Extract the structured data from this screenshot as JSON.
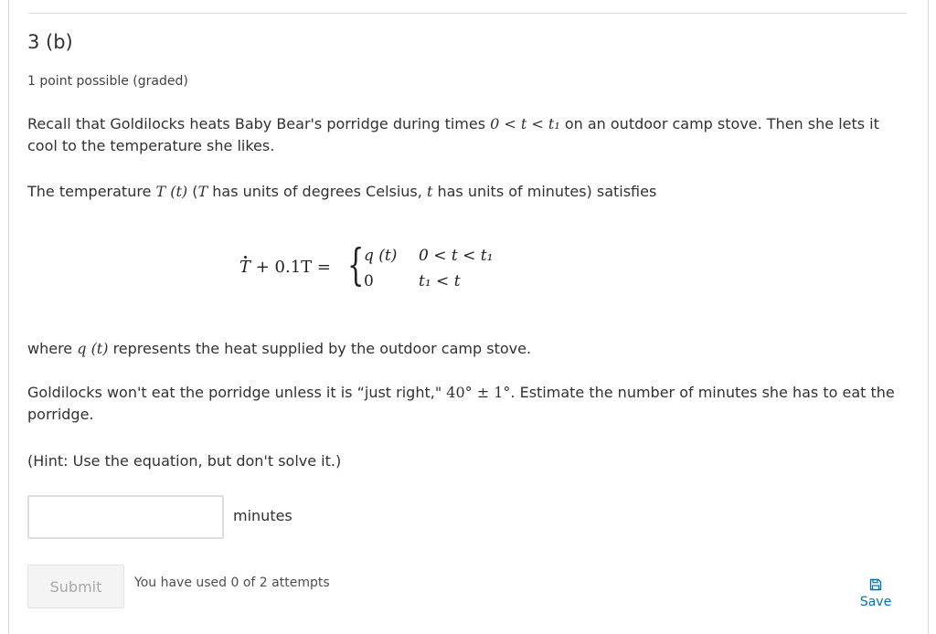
{
  "problem": {
    "title": "3 (b)",
    "points": "1 point possible (graded)"
  },
  "text": {
    "p1_a": "Recall that Goldilocks heats Baby Bear's porridge during times ",
    "p1_math": "0 < t < t₁",
    "p1_b": " on an outdoor camp stove. Then she lets it cool to the temperature she likes.",
    "p2_a": "The temperature ",
    "p2_math1": "T (t)",
    "p2_b": " (",
    "p2_math2": "T",
    "p2_c": " has units of degrees Celsius, ",
    "p2_math3": "t",
    "p2_d": " has units of minutes) satisfies",
    "p3_a": "where ",
    "p3_math": "q (t)",
    "p3_b": " represents the heat supplied by the outdoor camp stove.",
    "p4_a": "Goldilocks won't eat the porridge unless it is “just right,\" ",
    "p4_math": "40° ± 1°",
    "p4_b": ". Estimate the number of minutes she has to eat the porridge.",
    "p5": "(Hint: Use the equation, but don't solve it.)"
  },
  "equation": {
    "lhs_T": "T",
    "lhs_rest": " + 0.1T =",
    "case1_value": "q (t)",
    "case1_condition": "0 < t < t₁",
    "case2_value": "0",
    "case2_condition": "t₁ < t"
  },
  "answer": {
    "value": "",
    "placeholder": "",
    "unit": "minutes"
  },
  "actions": {
    "submit_label": "Submit",
    "attempts_text": "You have used 0 of 2 attempts",
    "save_label": "Save",
    "save_icon": "floppy-disk-icon",
    "save_color": "#0075b4"
  }
}
